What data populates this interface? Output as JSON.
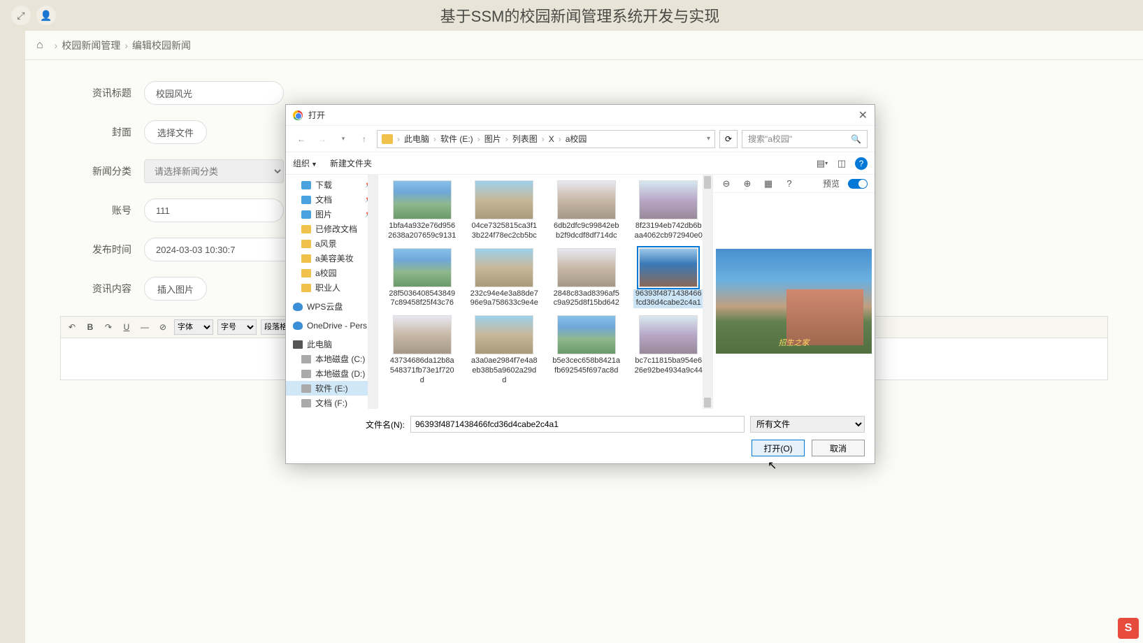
{
  "header": {
    "title": "基于SSM的校园新闻管理系统开发与实现"
  },
  "breadcrumb": {
    "level1": "校园新闻管理",
    "level2": "编辑校园新闻"
  },
  "form": {
    "title_label": "资讯标题",
    "title_value": "校园风光",
    "cover_label": "封面",
    "choose_file": "选择文件",
    "category_label": "新闻分类",
    "category_placeholder": "请选择新闻分类",
    "account_label": "账号",
    "account_value": "111",
    "time_label": "发布时间",
    "time_value": "2024-03-03 10:30:7",
    "content_label": "资讯内容",
    "insert_image": "插入图片"
  },
  "editor": {
    "font_label": "字体",
    "size_label": "字号",
    "para_label": "段落格式"
  },
  "dialog": {
    "title": "打开",
    "path": {
      "pc": "此电脑",
      "drive": "软件 (E:)",
      "p1": "图片",
      "p2": "列表图",
      "p3": "X",
      "p4": "a校园"
    },
    "search_placeholder": "搜索\"a校园\"",
    "organize": "组织",
    "new_folder": "新建文件夹",
    "preview_label": "预览",
    "filename_label": "文件名(N):",
    "filename_value": "96393f4871438466fcd36d4cabe2c4a1",
    "filetype_value": "所有文件",
    "open_btn": "打开(O)",
    "cancel_btn": "取消",
    "preview_caption": "招生之家"
  },
  "tree": {
    "downloads": "下载",
    "docs": "文档",
    "pics": "图片",
    "f1": "已修改文档",
    "f2": "a风景",
    "f3": "a美容美妆",
    "f4": "a校园",
    "f5": "职业人",
    "wps": "WPS云盘",
    "onedrive": "OneDrive - Pers",
    "thispc": "此电脑",
    "diskC": "本地磁盘 (C:)",
    "diskD": "本地磁盘 (D:)",
    "diskE": "软件 (E:)",
    "diskF": "文档 (F:)"
  },
  "files": [
    {
      "name": "1bfa4a932e76d9562638a207659c9131"
    },
    {
      "name": "04ce7325815ca3f13b224f78ec2cb5bc"
    },
    {
      "name": "6db2dfc9c99842ebb2f9dcdf8df714dc"
    },
    {
      "name": "8f23194eb742db6baa4062cb972940e0"
    },
    {
      "name": "28f50364085438497c89458f25f43c76"
    },
    {
      "name": "232c94e4e3a88de796e9a758633c9e4e"
    },
    {
      "name": "2848c83ad8396af5c9a925d8f15bd642"
    },
    {
      "name": "96393f4871438466fcd36d4cabe2c4a1"
    },
    {
      "name": "43734686da12b8a548371fb73e1f720d"
    },
    {
      "name": "a3a0ae2984f7e4a8eb38b5a9602a29dd"
    },
    {
      "name": "b5e3cec658b8421afb692545f697ac8d"
    },
    {
      "name": "bc7c11815ba954e626e92be4934a9c44"
    }
  ],
  "ime": "S"
}
